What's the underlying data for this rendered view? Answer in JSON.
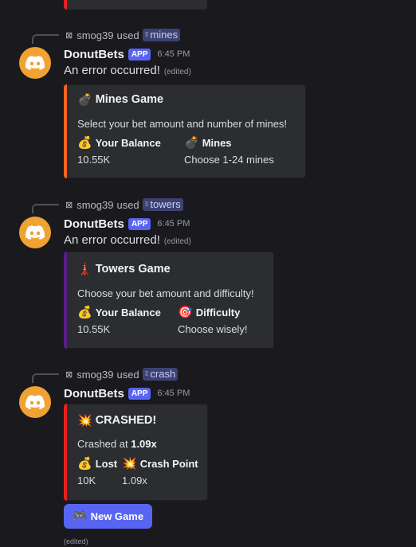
{
  "messages": [
    {
      "reply": {
        "icon": "⊠",
        "user": "smog39",
        "used": "used",
        "command": "mines",
        "cmd_icon": "⁝⁝"
      },
      "author": "DonutBets",
      "badge": "APP",
      "time": "6:45 PM",
      "content": "An error occurred!",
      "edited": "(edited)",
      "embed": {
        "accent": "#f26522",
        "title_emoji": "💣",
        "title": "Mines Game",
        "description": "Select your bet amount and number of mines!",
        "fields": [
          {
            "emoji": "💰",
            "name": "Your Balance",
            "value": "10.55K"
          },
          {
            "emoji": "💣",
            "name": "Mines",
            "value": "Choose 1-24 mines"
          }
        ]
      }
    },
    {
      "reply": {
        "icon": "⊠",
        "user": "smog39",
        "used": "used",
        "command": "towers",
        "cmd_icon": "⁝⁝"
      },
      "author": "DonutBets",
      "badge": "APP",
      "time": "6:45 PM",
      "content": "An error occurred!",
      "edited": "(edited)",
      "embed": {
        "accent": "#5a1d86",
        "title_emoji": "🗼",
        "title": "Towers Game",
        "description": "Choose your bet amount and difficulty!",
        "fields": [
          {
            "emoji": "💰",
            "name": "Your Balance",
            "value": "10.55K"
          },
          {
            "emoji": "🎯",
            "name": "Difficulty",
            "value": "Choose wisely!"
          }
        ]
      }
    },
    {
      "reply": {
        "icon": "⊠",
        "user": "smog39",
        "used": "used",
        "command": "crash",
        "cmd_icon": "⁝⁝"
      },
      "author": "DonutBets",
      "badge": "APP",
      "time": "6:45 PM",
      "embed": {
        "accent": "#e81f1f",
        "title_emoji": "💥",
        "title": "CRASHED!",
        "description_prefix": "Crashed at",
        "description_value": "1.09x",
        "fields": [
          {
            "emoji": "💰",
            "name": "Lost",
            "value": "10K"
          },
          {
            "emoji": "💥",
            "name": "Crash Point",
            "value": "1.09x"
          }
        ]
      },
      "button": {
        "emoji": "🎮",
        "label": "New Game"
      },
      "edited": "(edited)"
    }
  ],
  "colors": {
    "background": "#1a1a1e",
    "embed": "#2b2d31",
    "blurple": "#5865f2",
    "avatar": "#f0a232"
  }
}
